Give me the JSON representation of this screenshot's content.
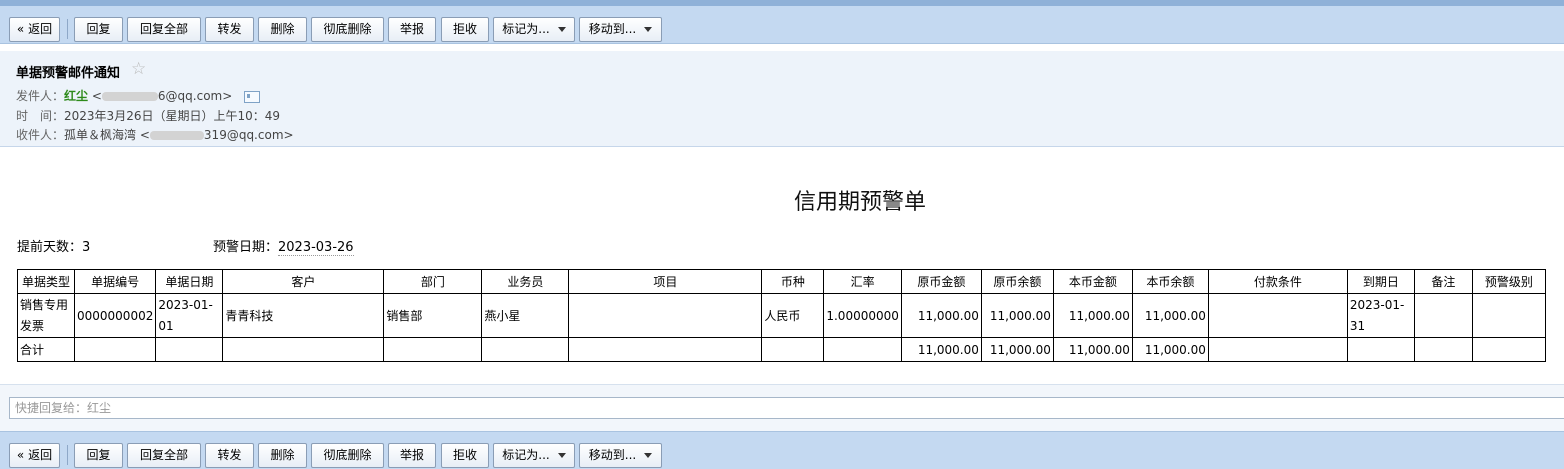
{
  "toolbar": {
    "back": "« 返回",
    "reply": "回复",
    "reply_all": "回复全部",
    "forward": "转发",
    "delete": "删除",
    "delete_permanently": "彻底删除",
    "report": "举报",
    "reject": "拒收",
    "mark_as": "标记为...",
    "move_to": "移动到..."
  },
  "email": {
    "subject": "单据预警邮件通知",
    "star": "☆",
    "sender_label": "发件人：",
    "sender_name": "红尘",
    "sender_email_prefix": "<",
    "sender_email_suffix": "6@qq.com>",
    "time_label": "时　间：",
    "time_value": "2023年3月26日（星期日）上午10：49",
    "recipient_label": "收件人：",
    "recipient_name": "孤单＆枫海湾",
    "recipient_email_prefix": "<",
    "recipient_email_suffix": "319@qq.com>"
  },
  "document": {
    "title": "信用期预警单",
    "advance_days_label": "提前天数：",
    "advance_days_value": "3",
    "warn_date_label": "预警日期：",
    "warn_date_value": "2023-03-26"
  },
  "table": {
    "headers": [
      "单据类型",
      "单据编号",
      "单据日期",
      "客户",
      "部门",
      "业务员",
      "项目",
      "币种",
      "汇率",
      "原币金额",
      "原币余额",
      "本币金额",
      "本币余额",
      "付款条件",
      "到期日",
      "备注",
      "预警级别"
    ],
    "row": [
      "销售专用发票",
      "0000000002",
      "2023-01-01",
      "青青科技",
      "销售部",
      "燕小星",
      "",
      "人民币",
      "1.00000000",
      "11,000.00",
      "11,000.00",
      "11,000.00",
      "11,000.00",
      "",
      "2023-01-31",
      "",
      ""
    ],
    "total": [
      "合计",
      "",
      "",
      "",
      "",
      "",
      "",
      "",
      "",
      "11,000.00",
      "11,000.00",
      "11,000.00",
      "11,000.00",
      "",
      "",
      "",
      ""
    ]
  },
  "quick_reply": {
    "placeholder": "快捷回复给：红尘"
  }
}
